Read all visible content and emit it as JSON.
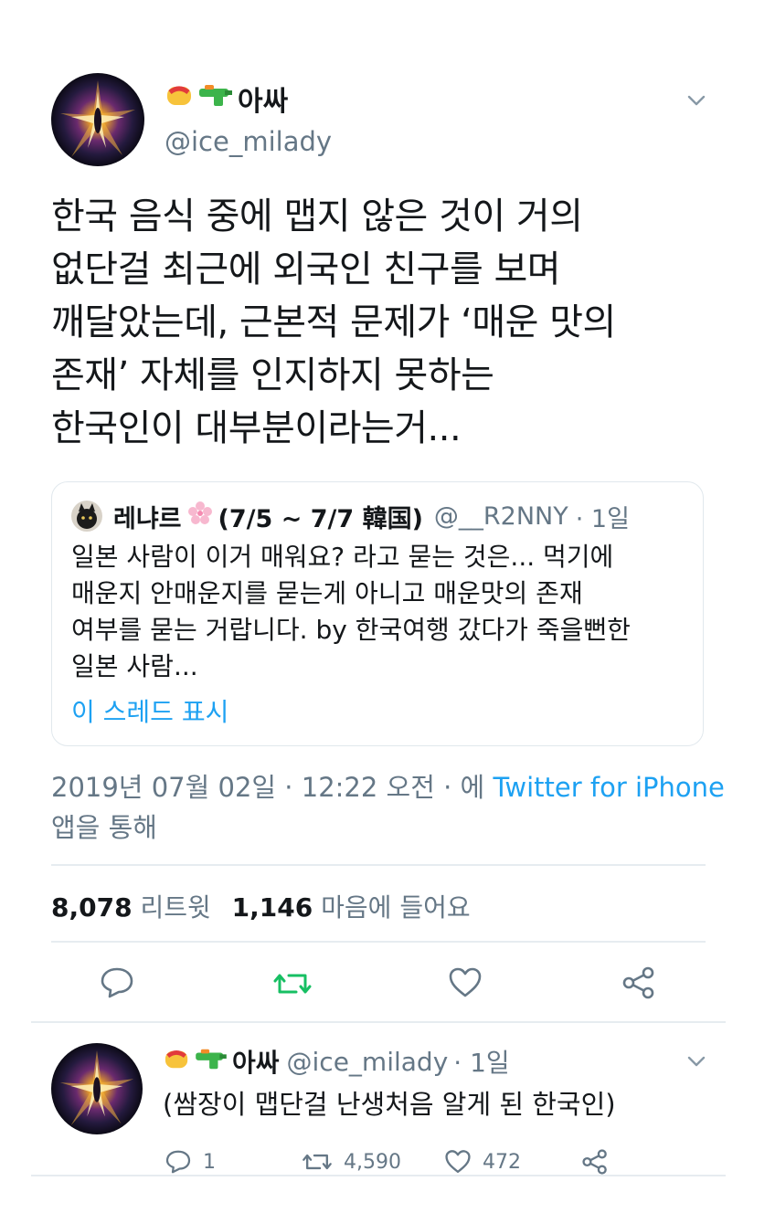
{
  "main_tweet": {
    "display_name": "아싸",
    "handle": "@ice_milady",
    "text": "한국 음식 중에 맵지 않은 것이 거의\n없단걸 최근에 외국인 친구를 보며\n깨달았는데, 근본적 문제가 ‘매운 맛의\n존재’ 자체를 인지하지 못하는\n한국인이 대부분이라는거...",
    "quote": {
      "display_name": "레냐르",
      "name_suffix": "(7/5 ~ 7/7 韓国)",
      "handle": "@__R2NNY",
      "time": "· 1일",
      "text": "일본 사람이 이거 매워요? 라고 묻는 것은... 먹기에\n매운지 안매운지를 묻는게 아니고 매운맛의 존재\n여부를 묻는 거랍니다. by 한국여행 갔다가 죽을뻔한\n일본 사람...",
      "show_thread": "이 스레드 표시"
    },
    "timestamp": "2019년 07월 02일 · 12:22 오전 · 에",
    "source_app": "Twitter for iPhone",
    "via_text": "앱을 통해",
    "retweet_count": "8,078",
    "retweet_label": "리트윗",
    "like_count": "1,146",
    "like_label": "마음에 들어요"
  },
  "reply_tweet": {
    "display_name": "아싸",
    "handle": "@ice_milady",
    "time": "· 1일",
    "text": "(쌈장이 맵단걸 난생처음 알게 된 한국인)",
    "reply_count": "1",
    "retweet_count": "4,590",
    "like_count": "472"
  },
  "colors": {
    "accent": "#1da1f2",
    "retweet_green": "#17bf63",
    "muted": "#657786",
    "text": "#14171a",
    "divider": "#e6ecf0"
  },
  "icons": {
    "reply": "speech-bubble-icon",
    "retweet": "retweet-arrows-icon",
    "like": "heart-icon",
    "share": "share-nodes-icon",
    "menu": "chevron-down-icon",
    "name_emoji_1": "fist-emoji-icon",
    "name_emoji_2": "water-pistol-emoji-icon",
    "quote_name_emoji": "cherry-blossom-emoji-icon"
  }
}
